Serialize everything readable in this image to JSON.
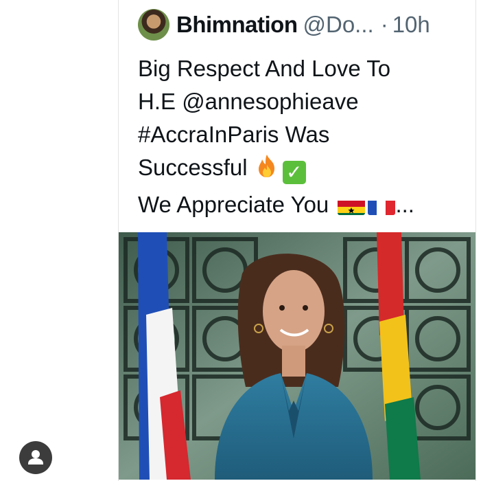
{
  "tweet": {
    "display_name": "Bhimnation",
    "handle": "@Do...",
    "separator": "·",
    "timestamp": "10h",
    "lines": {
      "l1": "Big Respect And Love To",
      "l2_prefix": "H.E ",
      "l2_mention": "@annesophieave",
      "l3_hashtag": "#AccraInParis",
      "l3_suffix": "  Was",
      "l4": "Successful",
      "l5": "We Appreciate You",
      "l5_ellipsis": "..."
    }
  },
  "icons": {
    "fire": "fire-emoji",
    "check": "white-check-mark-emoji",
    "flag_ghana": "ghana-flag-emoji",
    "flag_france": "france-flag-emoji",
    "fab": "user-icon"
  },
  "colors": {
    "text": "#0f1419",
    "secondary": "#536471",
    "check_green": "#5cbf3c",
    "fab_bg": "#3c3c3c"
  }
}
